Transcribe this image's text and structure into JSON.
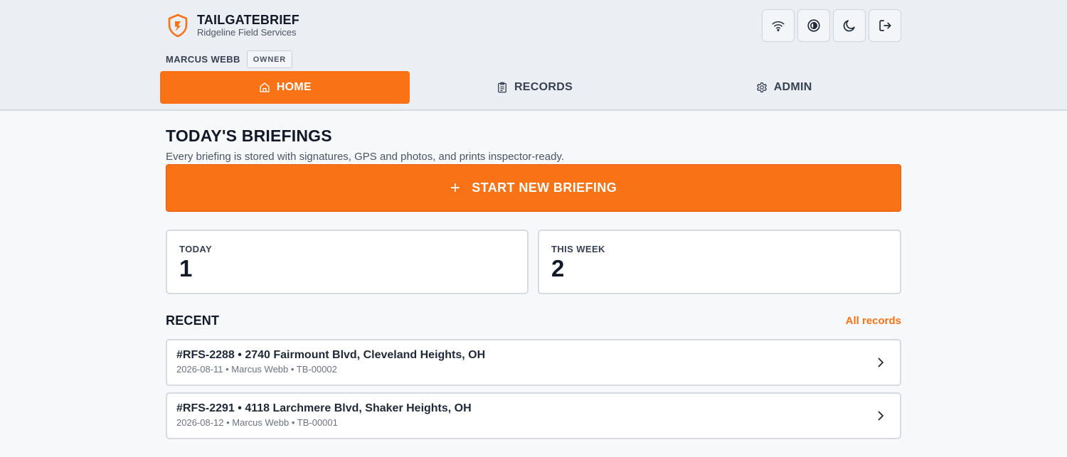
{
  "brand": {
    "name": "TAILGATEBRIEF",
    "company": "Ridgeline Field Services"
  },
  "toolbar": {
    "icons": [
      "wifi-icon",
      "contrast-icon",
      "moon-icon",
      "logout-icon"
    ]
  },
  "user": {
    "name": "MARCUS WEBB",
    "role": "OWNER"
  },
  "nav": {
    "tabs": [
      {
        "label": "HOME",
        "icon": "home-icon",
        "active": true
      },
      {
        "label": "RECORDS",
        "icon": "clipboard-icon",
        "active": false
      },
      {
        "label": "ADMIN",
        "icon": "gear-icon",
        "active": false
      }
    ]
  },
  "main": {
    "title": "TODAY'S BRIEFINGS",
    "subtitle": "Every briefing is stored with signatures, GPS and photos, and prints inspector-ready.",
    "start_button": {
      "plus": "+",
      "label": "START NEW BRIEFING"
    },
    "stats": [
      {
        "label": "TODAY",
        "value": "1"
      },
      {
        "label": "THIS WEEK",
        "value": "2"
      }
    ],
    "recent": {
      "heading": "RECENT",
      "link": "All records",
      "items": [
        {
          "title": "#RFS-2288 • 2740 Fairmount Blvd, Cleveland Heights, OH",
          "meta": "2026-08-11 • Marcus Webb • TB-00002"
        },
        {
          "title": "#RFS-2291 • 4118 Larchmere Blvd, Shaker Heights, OH",
          "meta": "2026-08-12 • Marcus Webb • TB-00001"
        }
      ]
    }
  },
  "colors": {
    "accent": "#f97316",
    "header_bg": "#ebeef2",
    "page_bg": "#f7f8fa"
  }
}
